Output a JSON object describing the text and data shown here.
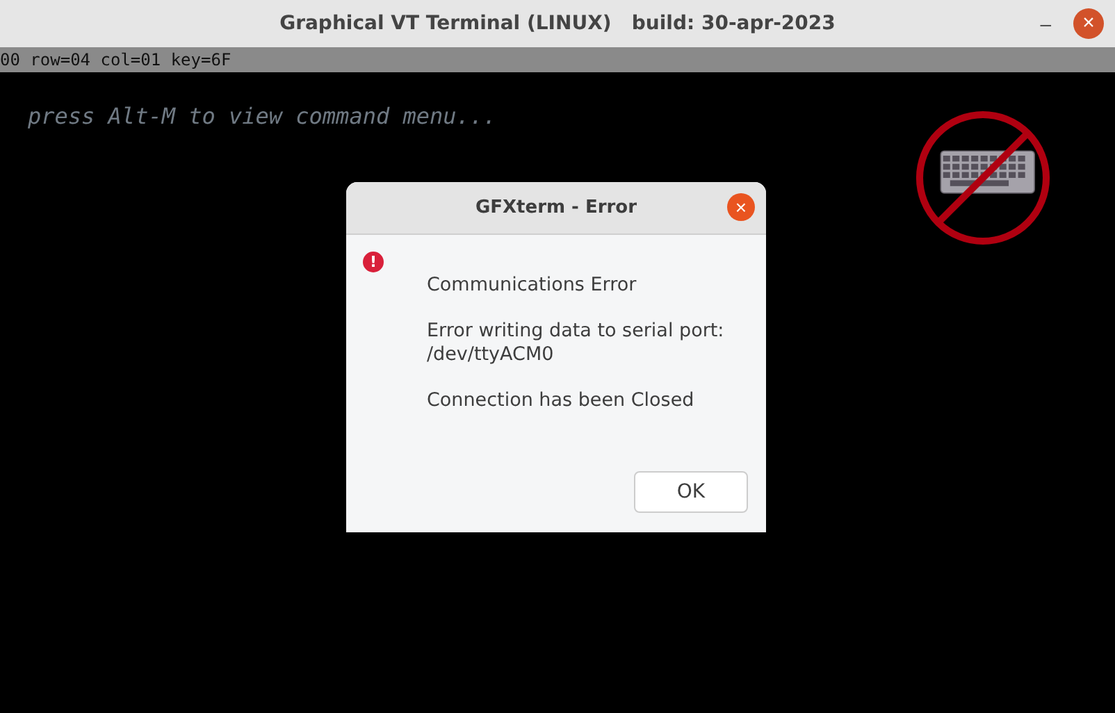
{
  "window": {
    "title": "Graphical VT Terminal (LINUX)   build: 30-apr-2023",
    "minimize": "–",
    "close": "×"
  },
  "status_bar": "00 row=04 col=01 key=6F",
  "terminal": {
    "lines": [
      "press Alt-M to view command menu..."
    ],
    "keyboard_disabled": true
  },
  "dialog": {
    "title": "GFXterm - Error",
    "close": "×",
    "icon": "!",
    "paragraphs": [
      "Communications Error",
      "Error writing data to serial port:\n/dev/ttyACM0",
      "Connection has been Closed"
    ],
    "buttons": [
      "OK"
    ]
  }
}
